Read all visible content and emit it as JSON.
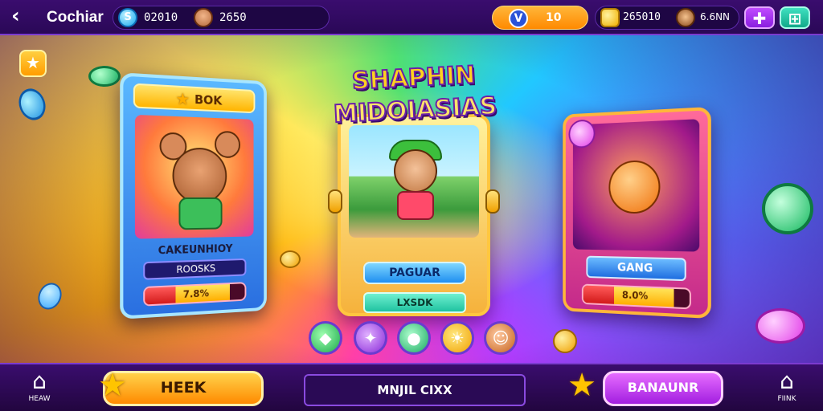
{
  "header": {
    "back_icon": "chevron-left-icon",
    "title": "Cochiar",
    "currency_a": "02010",
    "currency_b": "2650",
    "v_badge": "V",
    "v_count": "10",
    "gold": "265010",
    "other": "6.6NN",
    "plus_label": "✚",
    "grid_label": "⊞"
  },
  "logo": {
    "line1": "SHAPHIN",
    "line2": "MIDOIASIAS"
  },
  "cards": {
    "left": {
      "header": "BOK",
      "name": "CAKEUNHIOY",
      "subtitle": "ROOSKS",
      "progress_label": "7.8%",
      "progress_value": 0.78
    },
    "center": {
      "primary_button": "PAGUAR",
      "secondary_button": "LXSDK"
    },
    "right": {
      "button": "GANG",
      "progress_label": "8.0%",
      "progress_value": 0.8
    }
  },
  "icon_row": [
    "green-gem-icon",
    "purple-crystal-icon",
    "green-frog-icon",
    "sun-icon",
    "monkey-face-icon"
  ],
  "footer": {
    "left_nav_label": "HEAW",
    "left_button": "HEEK",
    "center_text": "MNJIL CIXX",
    "right_button": "BANAUNR",
    "right_nav_label": "FIINK"
  },
  "colors": {
    "topbar": "#3a0d6e",
    "accent_orange": "#ff8a00",
    "accent_purple": "#a21ee0",
    "accent_blue": "#1f8ef0"
  }
}
